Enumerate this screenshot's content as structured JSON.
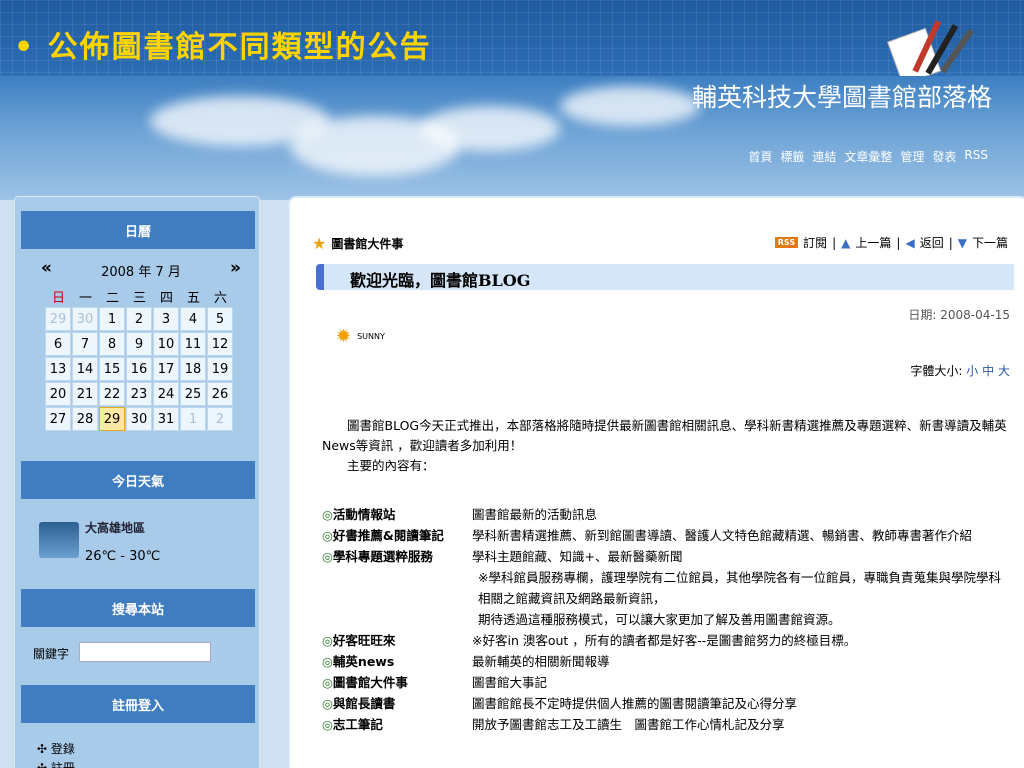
{
  "slide": {
    "title": "• 公佈圖書館不同類型的公告"
  },
  "banner": {
    "blog_name": "輔英科技大學圖書館部落格",
    "nav": [
      "首頁",
      "標籤",
      "連結",
      "文章彙整",
      "管理",
      "發表",
      "RSS"
    ]
  },
  "sidebar": {
    "calendar": {
      "heading": "日曆",
      "prev": "«",
      "month": "2008 年 7 月",
      "next": "»",
      "weekdays": [
        "日",
        "一",
        "二",
        "三",
        "四",
        "五",
        "六"
      ],
      "days": [
        "29",
        "30",
        "1",
        "2",
        "3",
        "4",
        "5",
        "6",
        "7",
        "8",
        "9",
        "10",
        "11",
        "12",
        "13",
        "14",
        "15",
        "16",
        "17",
        "18",
        "19",
        "20",
        "21",
        "22",
        "23",
        "24",
        "25",
        "26",
        "27",
        "28",
        "29",
        "30",
        "31",
        "1",
        "2"
      ]
    },
    "weather": {
      "heading": "今日天氣",
      "region": "大高雄地區",
      "temp": "26℃ - 30℃"
    },
    "search": {
      "heading": "搜尋本站",
      "keyword_label": "關鍵字",
      "keyword_value": ""
    },
    "account": {
      "heading": "註冊登入",
      "login": "✣ 登錄",
      "register": "✣ 註冊"
    }
  },
  "post": {
    "category": "圖書館大件事",
    "nav": {
      "rss": "RSS",
      "subscribe": "訂閱",
      "prev": "上一篇",
      "back": "返回",
      "next": "下一篇"
    },
    "title": "歡迎光臨，圖書館BLOG",
    "date": "日期: 2008-04-15",
    "mood": "SUNNY",
    "font_size": {
      "label": "字體大小:",
      "small": "小",
      "medium": "中",
      "large": "大"
    },
    "intro": [
      "　　圖書館BLOG今天正式推出，本部落格將隨時提供最新圖書館相關訊息、學科新書精選推薦及專題選粹、新書導讀及輔英News等資訊 ，歡迎讀者多加利用！",
      "　　主要的內容有："
    ],
    "sections": [
      {
        "name": "活動情報站",
        "desc": "圖書館最新的活動訊息"
      },
      {
        "name": "好書推薦&閱讀筆記",
        "desc": "學科新書精選推薦、新到館圖書導讀、醫護人文特色館藏精選、暢銷書、教師專書著作介紹"
      },
      {
        "name": "學科專題選粹服務",
        "desc": "學科主題館藏、知識+、最新醫藥新聞"
      },
      {
        "name": "",
        "desc": "※學科館員服務專欄，護理學院有二位館員，其他學院各有一位館員，專職負責蒐集與學院學科相關之館藏資訊及網路最新資訊，"
      },
      {
        "name": "",
        "desc": "期待透過這種服務模式，可以讓大家更加了解及善用圖書館資源。"
      },
      {
        "name": "好客旺旺來",
        "desc": "※好客in 澳客out ，所有的讀者都是好客--是圖書館努力的終極目標。"
      },
      {
        "name": "輔英news",
        "desc": "最新輔英的相關新聞報導"
      },
      {
        "name": "圖書館大件事",
        "desc": "圖書館大事記"
      },
      {
        "name": "與館長讀書",
        "desc": "圖書館館長不定時提供個人推薦的圖書閱讀筆記及心得分享"
      },
      {
        "name": "志工筆記",
        "desc": "開放予圖書館志工及工讀生　圖書館工作心情札記及分享"
      }
    ]
  }
}
